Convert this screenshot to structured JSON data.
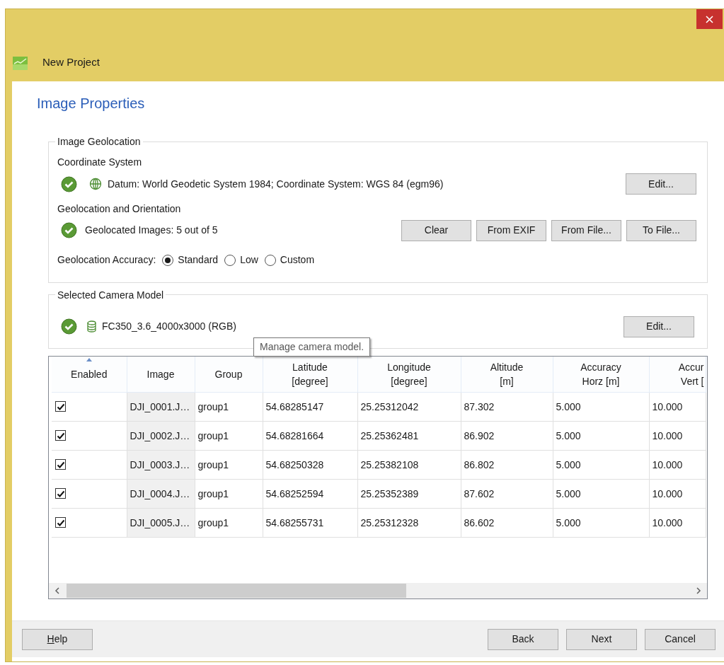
{
  "window": {
    "title": "New Project"
  },
  "page_title": "Image Properties",
  "geolocation": {
    "legend": "Image Geolocation",
    "coordinate_label": "Coordinate System",
    "coordinate_ok": true,
    "coordinate_text": "Datum: World Geodetic System 1984; Coordinate System: WGS 84 (egm96)",
    "coordinate_edit": "Edit...",
    "orientation_label": "Geolocation and Orientation",
    "orientation_ok": true,
    "orientation_text": "Geolocated Images: 5 out of 5",
    "buttons": [
      "Clear",
      "From EXIF",
      "From File...",
      "To File..."
    ],
    "accuracy_label": "Geolocation Accuracy:",
    "accuracy_options": [
      {
        "label": "Standard",
        "selected": true
      },
      {
        "label": "Low",
        "selected": false
      },
      {
        "label": "Custom",
        "selected": false
      }
    ]
  },
  "camera": {
    "legend": "Selected Camera Model",
    "ok": true,
    "model": "FC350_3.6_4000x3000 (RGB)",
    "edit": "Edit..."
  },
  "tooltip": "Manage camera model.",
  "table": {
    "columns": [
      {
        "label": "Enabled",
        "sorted": true
      },
      {
        "label": "Image",
        "sorted": false
      },
      {
        "label": "Group",
        "sorted": false
      },
      {
        "label": "Latitude\n[degree]",
        "sorted": false
      },
      {
        "label": "Longitude\n[degree]",
        "sorted": false
      },
      {
        "label": "Altitude\n[m]",
        "sorted": false
      },
      {
        "label": "Accuracy\nHorz [m]",
        "sorted": false
      },
      {
        "label": "Accur\nVert [",
        "sorted": false
      }
    ],
    "rows": [
      {
        "enabled": true,
        "cells": [
          "",
          "DJI_0001.J…",
          "group1",
          "54.68285147",
          "25.25312042",
          "87.302",
          "5.000",
          "10.000"
        ]
      },
      {
        "enabled": true,
        "cells": [
          "",
          "DJI_0002.J…",
          "group1",
          "54.68281664",
          "25.25362481",
          "86.902",
          "5.000",
          "10.000"
        ]
      },
      {
        "enabled": true,
        "cells": [
          "",
          "DJI_0003.J…",
          "group1",
          "54.68250328",
          "25.25382108",
          "86.802",
          "5.000",
          "10.000"
        ]
      },
      {
        "enabled": true,
        "cells": [
          "",
          "DJI_0004.J…",
          "group1",
          "54.68252594",
          "25.25352389",
          "87.602",
          "5.000",
          "10.000"
        ]
      },
      {
        "enabled": true,
        "cells": [
          "",
          "DJI_0005.J…",
          "group1",
          "54.68255731",
          "25.25312328",
          "86.602",
          "5.000",
          "10.000"
        ]
      }
    ]
  },
  "footer": {
    "help": "Help",
    "buttons": [
      "Back",
      "Next",
      "Cancel"
    ]
  }
}
